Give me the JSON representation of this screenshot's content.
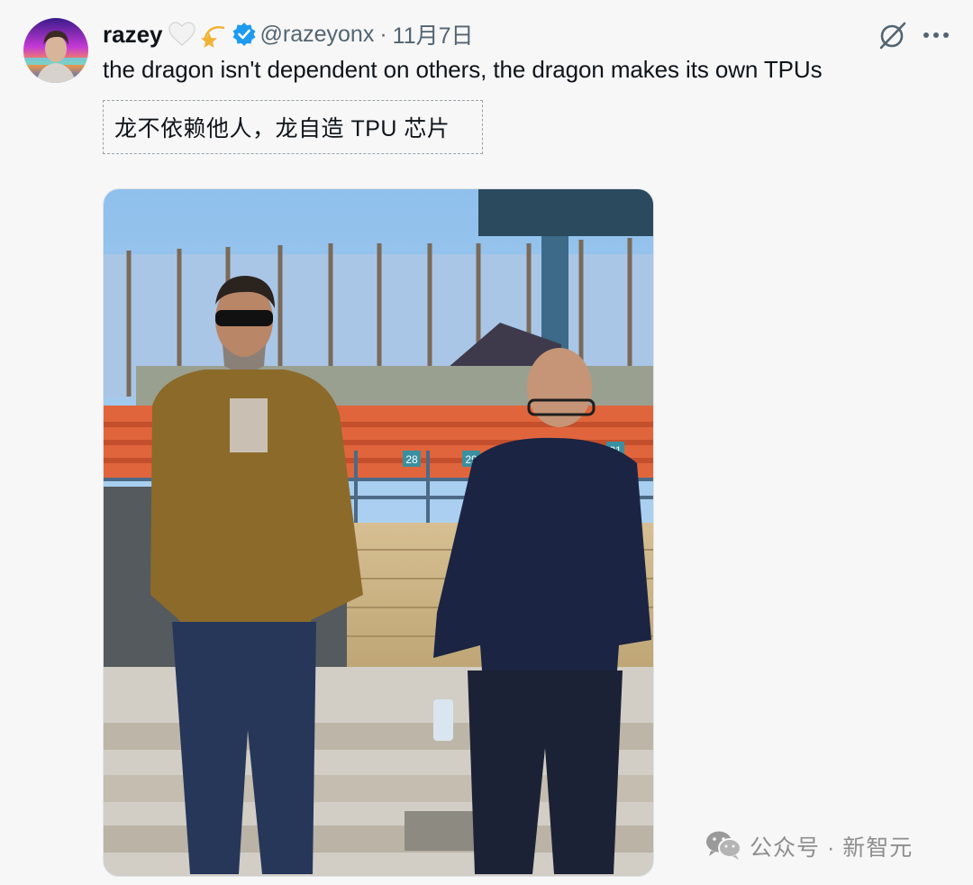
{
  "tweet": {
    "author_name": "razey",
    "badges": [
      "white-heart-icon",
      "dizzy-star-icon",
      "verified-badge-icon"
    ],
    "handle": "@razeyonx",
    "separator": "·",
    "date": "11月7日",
    "text": "the dragon isn't dependent on others, the dragon makes its own TPUs",
    "translation": "龙不依赖他人，龙自造 TPU 芯片",
    "actions": [
      "grok-icon",
      "more-options-icon"
    ]
  },
  "media": {
    "photo_signage": [
      "28",
      "29",
      "31"
    ]
  },
  "watermark": {
    "text": "公众号 · 新智元",
    "icon": "wechat-icon"
  },
  "colors": {
    "background": "#f7f7f7",
    "text": "#0f1419",
    "secondary_text": "#536471",
    "verified_blue": "#1d9bf0",
    "seat_orange": "#e0653c"
  }
}
